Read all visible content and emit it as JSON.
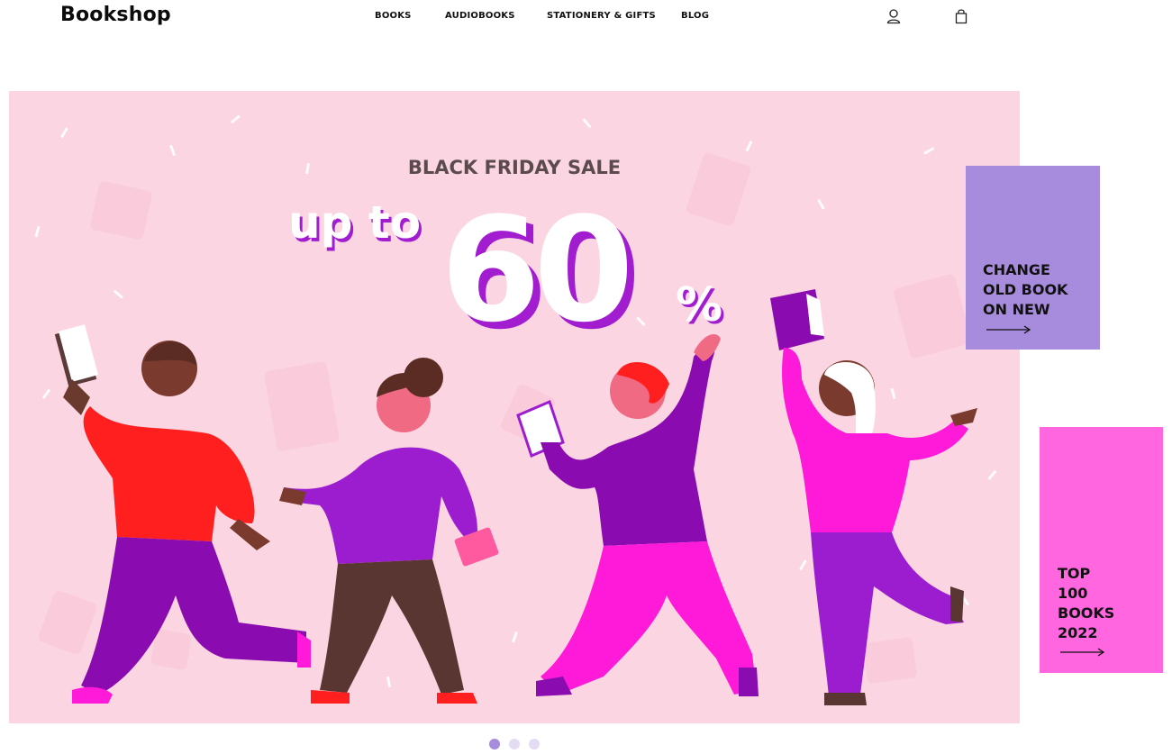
{
  "header": {
    "logo": "Bookshop",
    "nav": [
      {
        "label": "BOOKS"
      },
      {
        "label": "AUDIOBOOKS"
      },
      {
        "label": "STATIONERY & GIFTS"
      },
      {
        "label": "BLOG"
      }
    ],
    "icons": [
      "user-icon",
      "shopping-bag-icon"
    ]
  },
  "banner": {
    "headline": "BLACK FRIDAY SALE",
    "prefix": "up to",
    "amount": "60",
    "percent": "%",
    "illustration": "four people dancing with books"
  },
  "promos": [
    {
      "text": "CHANGE\nOLD BOOK\nON NEW",
      "color": "#a78bdc",
      "icon": "arrow-right-icon"
    },
    {
      "text": "TOP\n100\nBOOKS\n2022",
      "color": "#ff66e0",
      "icon": "arrow-right-icon"
    }
  ],
  "slider": {
    "count": 3,
    "active": 0,
    "active_color": "#a78bdc",
    "inactive_color": "#e3dcf2"
  },
  "colors": {
    "banner_bg": "#fbd5e1",
    "purple": "#8a0cb0",
    "magenta": "#ff1ad9",
    "red": "#ff1f1f"
  }
}
